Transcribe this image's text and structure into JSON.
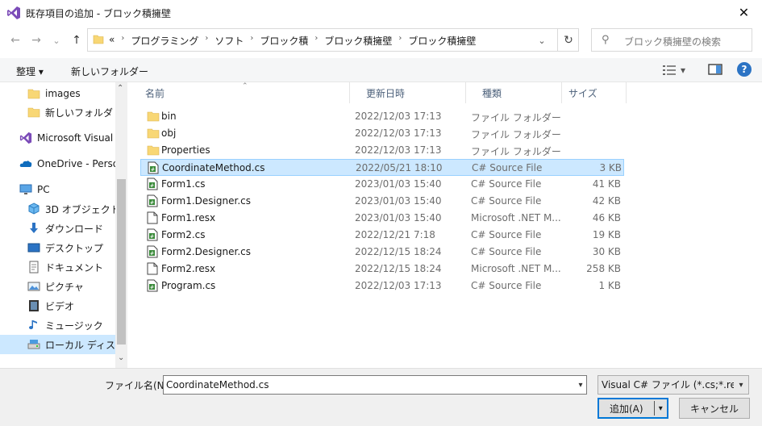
{
  "window": {
    "title": "既存項目の追加 - ブロック積擁壁",
    "close_glyph": "✕"
  },
  "nav": {
    "back_glyph": "←",
    "forward_glyph": "→",
    "recent_glyph": "⌄",
    "up_glyph": "↑",
    "breadcrumb_overflow": "«",
    "breadcrumbs": [
      "プログラミング",
      "ソフト",
      "ブロック積",
      "ブロック積擁壁",
      "ブロック積擁壁"
    ],
    "search_placeholder": "ブロック積擁壁の検索"
  },
  "toolbar": {
    "organize_label": "整理 ▾",
    "new_folder_label": "新しいフォルダー",
    "help_label": "?"
  },
  "sidebar": {
    "items": [
      {
        "label": "images",
        "icon": "folder-icon"
      },
      {
        "label": "新しいフォルダ",
        "icon": "folder-icon"
      },
      {
        "label": "Microsoft Visual S",
        "icon": "visual-studio-icon"
      },
      {
        "label": "OneDrive - Person",
        "icon": "onedrive-icon"
      },
      {
        "label": "PC",
        "icon": "pc-icon"
      },
      {
        "label": "3D オブジェクト",
        "icon": "3d-objects-icon"
      },
      {
        "label": "ダウンロード",
        "icon": "download-icon"
      },
      {
        "label": "デスクトップ",
        "icon": "desktop-icon"
      },
      {
        "label": "ドキュメント",
        "icon": "documents-icon"
      },
      {
        "label": "ピクチャ",
        "icon": "pictures-icon"
      },
      {
        "label": "ビデオ",
        "icon": "videos-icon"
      },
      {
        "label": "ミュージック",
        "icon": "music-icon"
      },
      {
        "label": "ローカル ディスク (C",
        "icon": "local-disk-icon"
      }
    ]
  },
  "columns": {
    "name": "名前",
    "date": "更新日時",
    "type": "種類",
    "size": "サイズ"
  },
  "files": [
    {
      "name": "bin",
      "date": "2022/12/03 17:13",
      "type": "ファイル フォルダー",
      "size": "",
      "icon": "folder-icon"
    },
    {
      "name": "obj",
      "date": "2022/12/03 17:13",
      "type": "ファイル フォルダー",
      "size": "",
      "icon": "folder-icon"
    },
    {
      "name": "Properties",
      "date": "2022/12/03 17:13",
      "type": "ファイル フォルダー",
      "size": "",
      "icon": "folder-icon"
    },
    {
      "name": "CoordinateMethod.cs",
      "date": "2022/05/21 18:10",
      "type": "C# Source File",
      "size": "3 KB",
      "icon": "csharp-file-icon",
      "selected": true
    },
    {
      "name": "Form1.cs",
      "date": "2023/01/03 15:40",
      "type": "C# Source File",
      "size": "41 KB",
      "icon": "csharp-file-icon"
    },
    {
      "name": "Form1.Designer.cs",
      "date": "2023/01/03 15:40",
      "type": "C# Source File",
      "size": "42 KB",
      "icon": "csharp-file-icon"
    },
    {
      "name": "Form1.resx",
      "date": "2023/01/03 15:40",
      "type": "Microsoft .NET M...",
      "size": "46 KB",
      "icon": "resx-file-icon"
    },
    {
      "name": "Form2.cs",
      "date": "2022/12/21 7:18",
      "type": "C# Source File",
      "size": "19 KB",
      "icon": "csharp-file-icon"
    },
    {
      "name": "Form2.Designer.cs",
      "date": "2022/12/15 18:24",
      "type": "C# Source File",
      "size": "30 KB",
      "icon": "csharp-file-icon"
    },
    {
      "name": "Form2.resx",
      "date": "2022/12/15 18:24",
      "type": "Microsoft .NET M...",
      "size": "258 KB",
      "icon": "resx-file-icon"
    },
    {
      "name": "Program.cs",
      "date": "2022/12/03 17:13",
      "type": "C# Source File",
      "size": "1 KB",
      "icon": "csharp-file-icon"
    }
  ],
  "footer": {
    "filename_label": "ファイル名(N):",
    "filename_value": "CoordinateMethod.cs",
    "filter_value": "Visual C# ファイル (*.cs;*.resx;*.re",
    "add_label": "追加(A)",
    "cancel_label": "キャンセル",
    "dropdown_glyph": "▾"
  },
  "colors": {
    "selection": "#cce8ff",
    "selection_border": "#99d1ff",
    "accent": "#0078d7",
    "folder": "#f8d775"
  }
}
